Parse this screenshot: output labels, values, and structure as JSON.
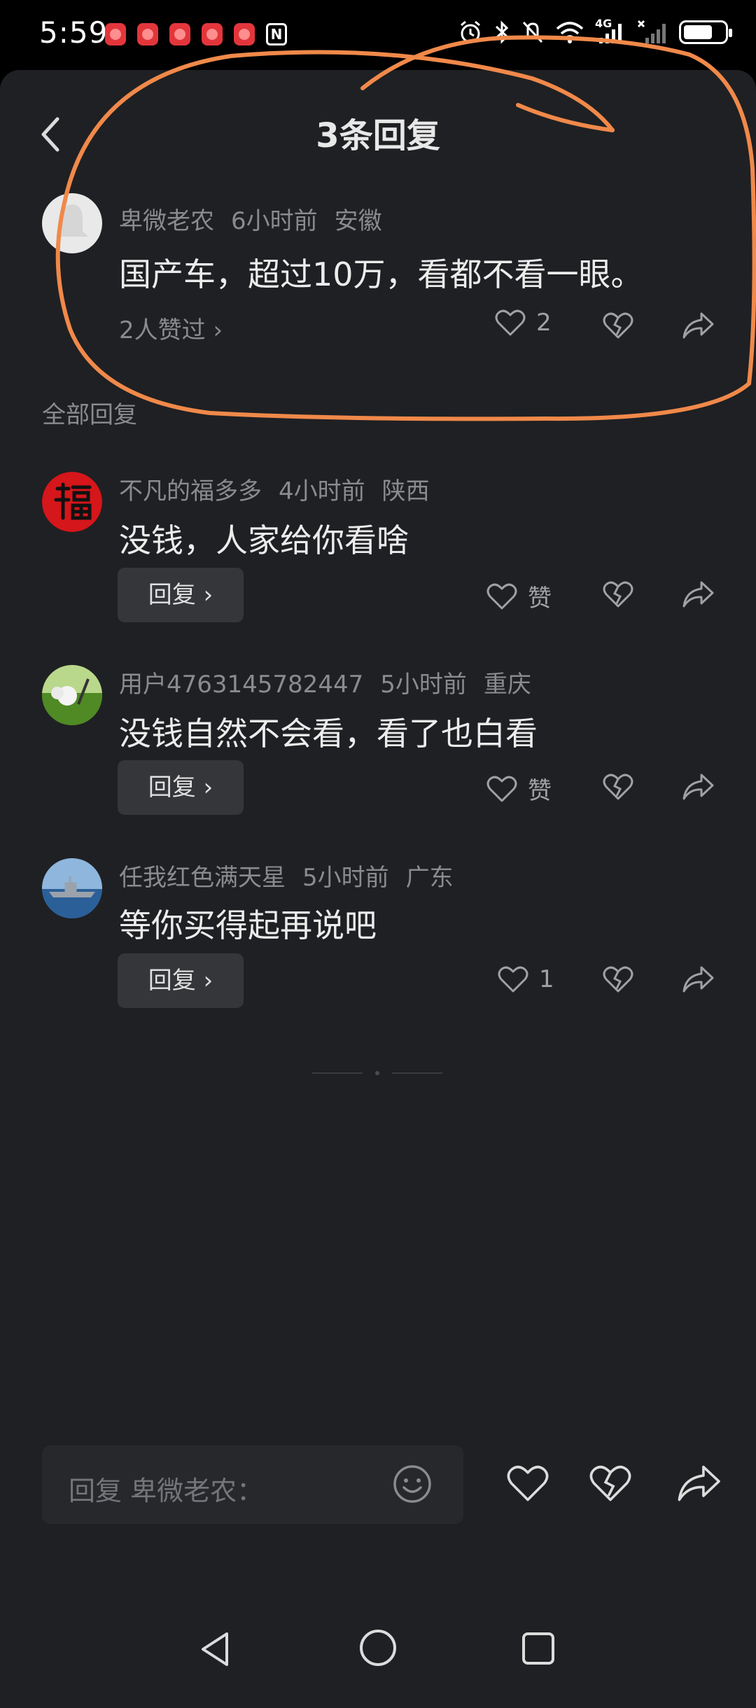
{
  "status_bar": {
    "time": "5:59",
    "network": "4G"
  },
  "header": {
    "title": "3条回复"
  },
  "main_comment": {
    "user": "卑微老农",
    "time": "6小时前",
    "location": "安徽",
    "text": "国产车，超过10万，看都不看一眼。",
    "liked_by": "2人赞过 ›",
    "like_count": "2"
  },
  "section": {
    "label": "全部回复"
  },
  "replies": [
    {
      "user": "不凡的福多多",
      "time": "4小时前",
      "location": "陕西",
      "text": "没钱，人家给你看啥",
      "reply_label": "回复 ›",
      "like_label": "赞"
    },
    {
      "user": "用户4763145782447",
      "time": "5小时前",
      "location": "重庆",
      "text": "没钱自然不会看，看了也白看",
      "reply_label": "回复 ›",
      "like_label": "赞"
    },
    {
      "user": "任我红色满天星",
      "time": "5小时前",
      "location": "广东",
      "text": "等你买得起再说吧",
      "reply_label": "回复 ›",
      "like_label": "1"
    }
  ],
  "input": {
    "placeholder": "回复 卑微老农："
  },
  "colors": {
    "background": "#1f2023",
    "annotation": "#f0894a"
  },
  "icons": [
    "back-icon",
    "heart-icon",
    "broken-heart-icon",
    "share-icon",
    "emoji-icon",
    "nav-back-icon",
    "nav-home-icon",
    "nav-recents-icon"
  ]
}
